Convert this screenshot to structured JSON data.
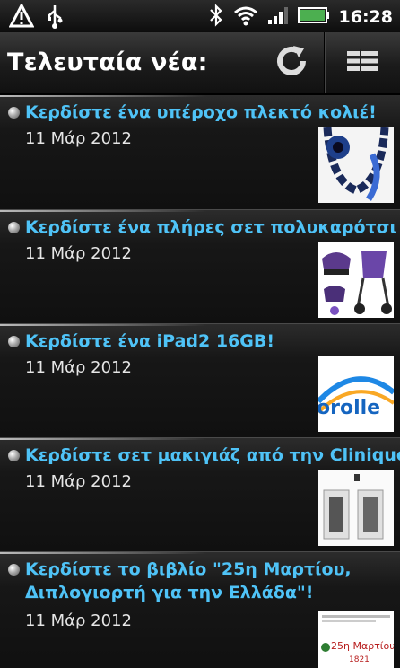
{
  "status_bar": {
    "time": "16:28",
    "icons": [
      "warning-icon",
      "usb-icon",
      "bluetooth-icon",
      "wifi-icon",
      "signal-icon",
      "battery-icon"
    ]
  },
  "header": {
    "title": "Τελευταία νέα:",
    "refresh_icon": "refresh-icon",
    "menu_icon": "list-menu-icon"
  },
  "items": [
    {
      "title": "Κερδίστε ένα υπέροχο πλεκτό κολιέ!",
      "date": "11 Μάρ 2012"
    },
    {
      "title": "Κερδίστε ένα πλήρες σετ πολυκαρότσι !",
      "date": "11 Μάρ 2012"
    },
    {
      "title": "Κερδίστε ένα iPad2 16GB!",
      "date": "11 Μάρ 2012",
      "thumb_text": "orolle"
    },
    {
      "title": "Κερδίστε σετ μακιγιάζ από την Clinique!",
      "date": "11 Μάρ 2012"
    },
    {
      "title": "Κερδίστε το βιβλίο \"25η Μαρτίου, Διπλογιορτή για την Ελλάδα\"!",
      "date": "11 Μάρ 2012",
      "thumb_text": "25η Μαρτίου",
      "thumb_year": "1821"
    }
  ],
  "colors": {
    "accent": "#4fc3f7",
    "battery": "#4caf50"
  }
}
